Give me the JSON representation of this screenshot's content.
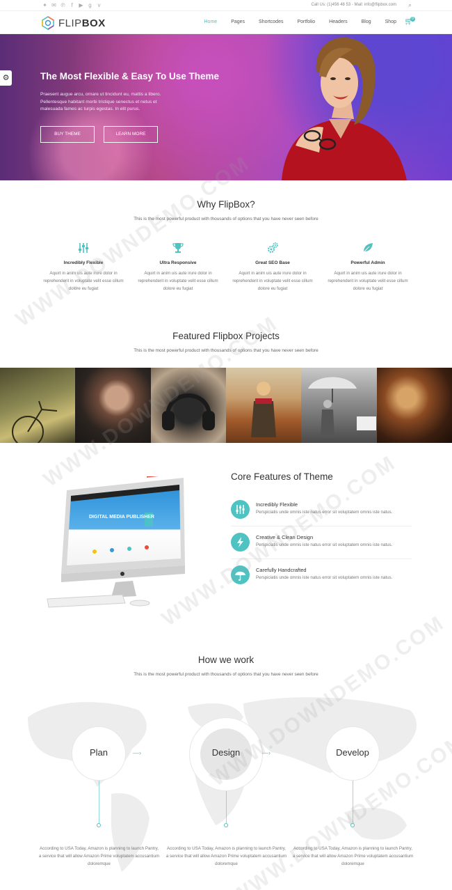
{
  "colors": {
    "accent": "#4ec3c1",
    "hero_start": "#5a2d77",
    "hero_end": "#6f3fd0"
  },
  "topbar": {
    "social_icons": [
      "twitter-icon",
      "mail-icon",
      "pinterest-icon",
      "facebook-icon",
      "youtube-icon",
      "google-plus-icon",
      "vimeo-icon"
    ],
    "contact": "Call Us: (1)456 48 53 - Mail: info@flipbox.com"
  },
  "header": {
    "logo_light": "FLIP",
    "logo_bold": "BOX",
    "nav": [
      "Home",
      "Pages",
      "Shortcodes",
      "Portfolio",
      "Headers",
      "Blog",
      "Shop"
    ],
    "active_nav": "Home",
    "cart_count": "0"
  },
  "hero": {
    "title": "The Most Flexible & Easy To Use Theme",
    "text": "Praesent augue arcu, ornare ut tincidunt eu, mattis a libero. Pellentesque habitant morbi tristique senectus et netus et malesuada fames ac turpis egestas. In elit purus.",
    "buy_label": "BUY THEME",
    "learn_label": "LEARN MORE"
  },
  "why": {
    "title": "Why FlipBox?",
    "subtitle": "This is the most powerful product with thousands of options that you have never seen before",
    "items": [
      {
        "icon": "sliders-icon",
        "name": "Incredibly Flexible",
        "desc": "Aquirt in anim uis aute irure dolor in reprehenderit in voluptate velit esse cillum dolore eu fugiat"
      },
      {
        "icon": "trophy-icon",
        "name": "Ultra Responsive",
        "desc": "Aquirt in anim uis aute irure dolor in reprehenderit in voluptate velit esse cillum dolore eu fugiat"
      },
      {
        "icon": "gears-icon",
        "name": "Great SEO Base",
        "desc": "Aquirt in anim uis aute irure dolor in reprehenderit in voluptate velit esse cillum dolore eu fugiat"
      },
      {
        "icon": "leaf-icon",
        "name": "Powerful Admin",
        "desc": "Aquirt in anim uis aute irure dolor in reprehenderit in voluptate velit esse cillum dolore eu fugiat"
      }
    ]
  },
  "projects": {
    "title": "Featured Flipbox Projects",
    "subtitle": "This is the most powerful product with thousands of options that you have never seen before"
  },
  "core": {
    "title": "Core Features of Theme",
    "screen_headline": "DIGITAL MEDIA PUBLISHER",
    "features": [
      {
        "icon": "sliders-icon",
        "name": "Incredibly Flexible",
        "desc": "Perspiciatis unde omnis iste natus error sit voluptatem omnis iste natus."
      },
      {
        "icon": "bolt-icon",
        "name": "Creative & Clean Design",
        "desc": "Perspiciatis unde omnis iste natus error sit voluptatem omnis iste natus."
      },
      {
        "icon": "umbrella-icon",
        "name": "Carefully Handcrafted",
        "desc": "Perspiciatis unde omnis iste natus error sit voluptatem omnis iste natus."
      }
    ]
  },
  "how": {
    "title": "How we work",
    "subtitle": "This is the most powerful product with thousands of options that you have never seen before",
    "steps": [
      {
        "label": "Plan",
        "desc": "According to USA Today, Amazon is planning to launch Pantry, a service that will allow Amazon Prime voluptatem accusantium doloremque"
      },
      {
        "label": "Design",
        "desc": "According to USA Today, Amazon is planning to launch Pantry, a service that will allow Amazon Prime voluptatem accusantium doloremque"
      },
      {
        "label": "Develop",
        "desc": "According to USA Today, Amazon is planning to launch Pantry, a service that will allow Amazon Prime voluptatem accusantium doloremque"
      }
    ]
  },
  "watermark": "WWW.DOWNDEMO.COM"
}
